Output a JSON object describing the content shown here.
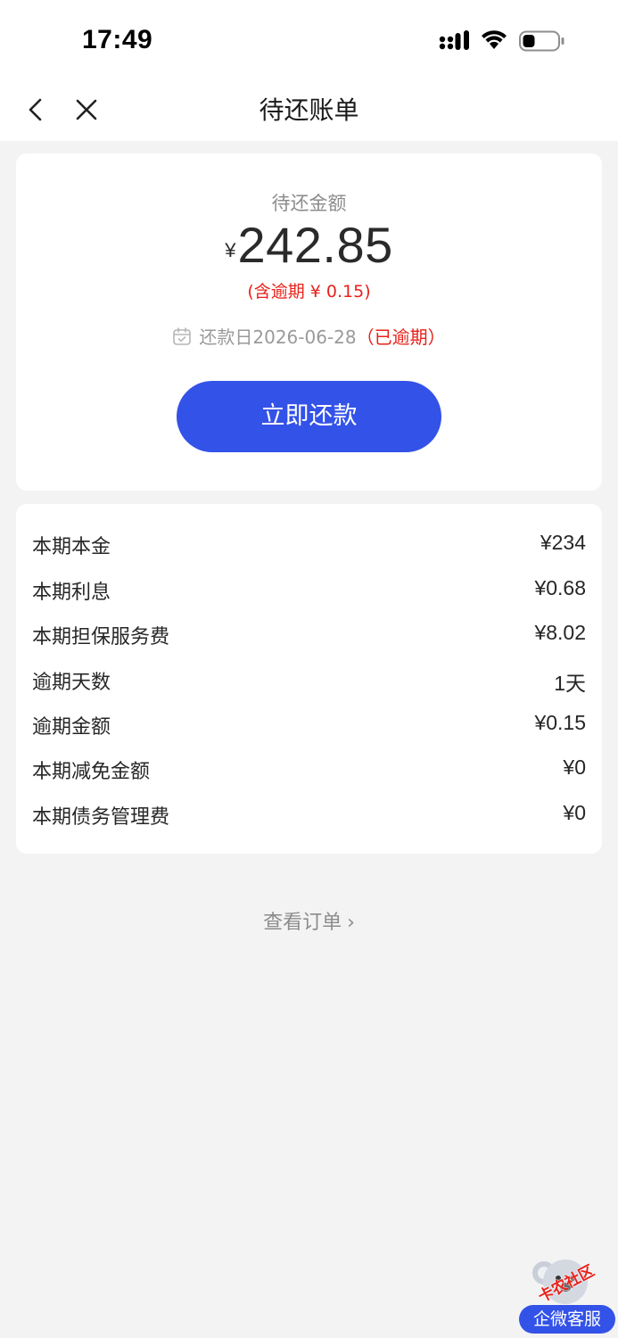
{
  "status_bar": {
    "time": "17:49"
  },
  "nav": {
    "title": "待还账单"
  },
  "summary": {
    "due_label": "待还金额",
    "currency": "¥",
    "amount": "242.85",
    "overdue_note": "(含逾期 ¥ 0.15)",
    "due_date_text": "还款日2026-06-28",
    "overdue_tag": "（已逾期）",
    "pay_button": "立即还款"
  },
  "details": [
    {
      "label": "本期本金",
      "value": "¥234"
    },
    {
      "label": "本期利息",
      "value": "¥0.68"
    },
    {
      "label": "本期担保服务费",
      "value": "¥8.02"
    },
    {
      "label": "逾期天数",
      "value": "1天"
    },
    {
      "label": "逾期金额",
      "value": "¥0.15"
    },
    {
      "label": "本期减免金额",
      "value": "¥0"
    },
    {
      "label": "本期债务管理费",
      "value": "¥0"
    }
  ],
  "view_order": {
    "label": "查看订单",
    "chevron": "›"
  },
  "customer_service": {
    "watermark": "卡农社区",
    "label": "企微客服"
  },
  "colors": {
    "accent": "#3352e8",
    "alert": "#e8211a",
    "muted": "#8c8c8c"
  }
}
